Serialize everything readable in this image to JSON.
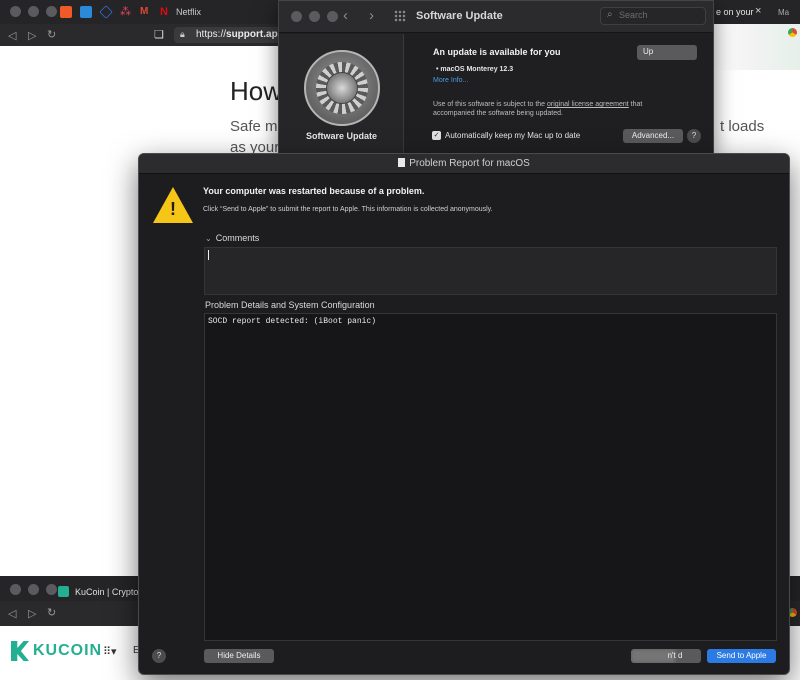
{
  "browser": {
    "tab_netflix_label": "Netflix",
    "tab_right_text": "e on your",
    "tab_close_glyph": "×",
    "tab_overflow_text": "Ma",
    "url_scheme": "https://",
    "url_host": "support.app",
    "page_heading": "How",
    "page_line_1_left": "Safe mo",
    "page_line_1_right": "t loads",
    "page_line_2": "as your"
  },
  "software_update": {
    "window_title": "Software Update",
    "search_placeholder": "Search",
    "sidebar_label": "Software Update",
    "headline": "An update is available for you",
    "update_button_label": "Up",
    "version_line": "• macOS Monterey 12.3",
    "more_info_link": "More Info...",
    "license_text_prefix": "Use of this software is subject to the ",
    "license_link": "original license agreement",
    "license_text_suffix": " that accompanied the software being updated.",
    "auto_update_label": "Automatically keep my Mac up to date",
    "auto_update_checked": true,
    "advanced_button_label": "Advanced...",
    "help_label": "?"
  },
  "problem_report": {
    "window_title": "Problem Report for macOS",
    "headline": "Your computer was restarted because of a problem.",
    "subtext": "Click “Send to Apple” to submit the report to Apple. This information is collected anonymously.",
    "comments_label": "Comments",
    "comments_value": "",
    "details_label": "Problem Details and System Configuration",
    "details_text": "SOCD report detected: (iBoot panic)",
    "help_label": "?",
    "hide_details_label": "Hide Details",
    "dont_send_visible_label": "n't   d",
    "send_button_label": "Send to Apple"
  },
  "kucoin": {
    "tab_label": "KuCoin | Crypto",
    "logo_text": "KUCOIN",
    "nav_fragment": "E"
  },
  "colors": {
    "accent_blue": "#2c7be5",
    "link_blue": "#4a9be5",
    "warning_yellow": "#f5c518",
    "kucoin_green": "#23af91"
  }
}
